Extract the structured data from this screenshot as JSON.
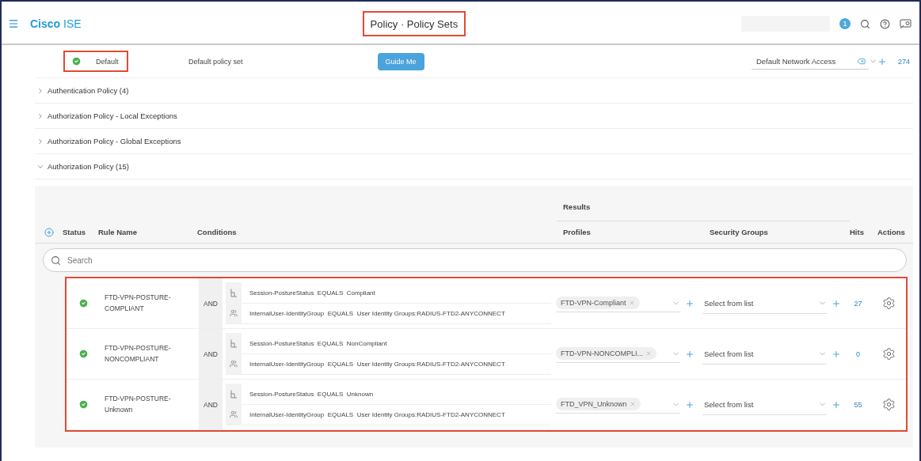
{
  "header": {
    "brand_bold": "Cisco",
    "brand_rest": "ISE",
    "title": "Policy · Policy Sets",
    "title_highlighted": true,
    "notification_count": "1"
  },
  "policy_set": {
    "enabled": true,
    "name": "Default",
    "name_highlighted": true,
    "description": "Default policy set",
    "guide_button": "Guide Me",
    "allowed_protocols": "Default Network Access",
    "hits": "274"
  },
  "sections": [
    {
      "label": "Authentication Policy (4)",
      "expanded": false
    },
    {
      "label": "Authorization Policy - Local Exceptions",
      "expanded": false
    },
    {
      "label": "Authorization Policy - Global Exceptions",
      "expanded": false
    },
    {
      "label": "Authorization Policy (15)",
      "expanded": true
    }
  ],
  "table": {
    "group_header": "Results",
    "columns": [
      "Status",
      "Rule Name",
      "Conditions",
      "Profiles",
      "Security Groups",
      "Hits",
      "Actions"
    ],
    "search": {
      "placeholder": "Search"
    },
    "rows_highlighted": true,
    "rows": [
      {
        "enabled": true,
        "name": "FTD-VPN-POSTURE-COMPLIANT",
        "operator": "AND",
        "conditions": [
          {
            "kind": "session",
            "attribute": "Session-PostureStatus",
            "op": "EQUALS",
            "value": "Compliant"
          },
          {
            "kind": "identity",
            "attribute": "InternalUser-IdentityGroup",
            "op": "EQUALS",
            "value": "User Identity Groups:RADIUS-FTD2-ANYCONNECT"
          }
        ],
        "profile": "FTD-VPN-Compliant",
        "security_group": {
          "placeholder": "Select from list"
        },
        "hits": "27"
      },
      {
        "enabled": true,
        "name": "FTD-VPN-POSTURE-NONCOMPLIANT",
        "operator": "AND",
        "conditions": [
          {
            "kind": "session",
            "attribute": "Session-PostureStatus",
            "op": "EQUALS",
            "value": "NonCompliant"
          },
          {
            "kind": "identity",
            "attribute": "InternalUser-IdentityGroup",
            "op": "EQUALS",
            "value": "User Identity Groups:RADIUS-FTD2-ANYCONNECT"
          }
        ],
        "profile": "FTD-VPN-NONCOMPLI...",
        "security_group": {
          "placeholder": "Select from list"
        },
        "hits": "0"
      },
      {
        "enabled": true,
        "name": "FTD-VPN-POSTURE-Unknown",
        "operator": "AND",
        "conditions": [
          {
            "kind": "session",
            "attribute": "Session-PostureStatus",
            "op": "EQUALS",
            "value": "Unknown"
          },
          {
            "kind": "identity",
            "attribute": "InternalUser-IdentityGroup",
            "op": "EQUALS",
            "value": "User Identity Groups:RADIUS-FTD2-ANYCONNECT"
          }
        ],
        "profile": "FTD_VPN_Unknown",
        "security_group": {
          "placeholder": "Select from list"
        },
        "hits": "55"
      }
    ]
  }
}
